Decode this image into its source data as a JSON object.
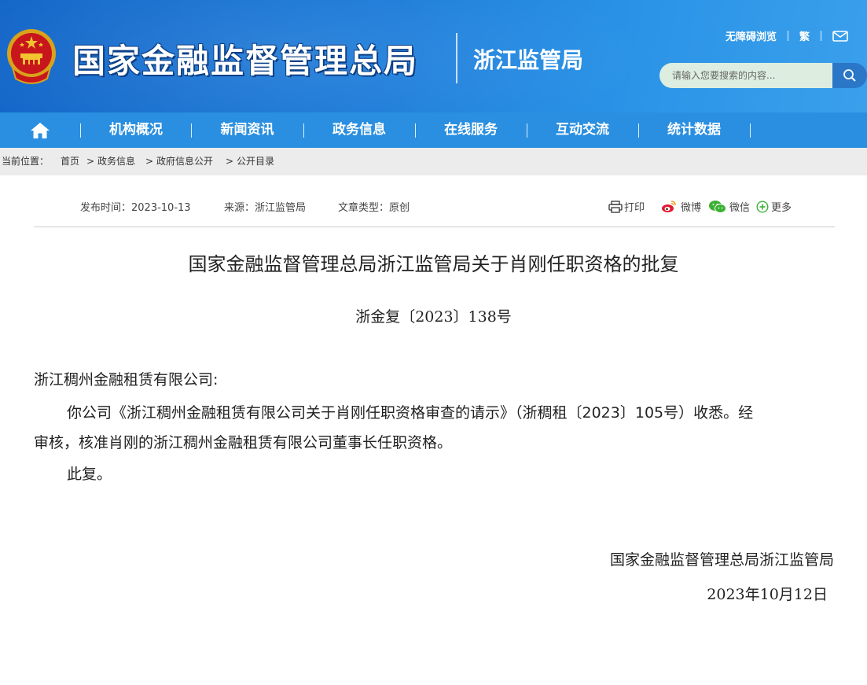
{
  "header": {
    "site_title": "国家金融监督管理总局",
    "sub_title": "浙江监管局",
    "top_links": {
      "accessibility": "无障碍浏览",
      "traditional": "繁"
    },
    "search": {
      "placeholder": "请输入您要搜索的内容..."
    },
    "colors": {
      "header_blue": "#1a7bd9",
      "nav_blue": "#2a8fe0",
      "search_bg": "#ddeee0"
    }
  },
  "nav": {
    "items": [
      {
        "label": "机构概况"
      },
      {
        "label": "新闻资讯"
      },
      {
        "label": "政务信息"
      },
      {
        "label": "在线服务"
      },
      {
        "label": "互动交流"
      },
      {
        "label": "统计数据"
      }
    ]
  },
  "breadcrumb": {
    "prefix": "当前位置：",
    "items": [
      "首页",
      "政务信息",
      "政府信息公开",
      "公开目录"
    ],
    "separator": ">"
  },
  "meta": {
    "publish_time": "发布时间：2023-10-13",
    "source": "来源：浙江监管局",
    "article_type": "文章类型：原创"
  },
  "share": {
    "print": "打印",
    "weibo": "微博",
    "wechat": "微信",
    "more": "更多"
  },
  "document": {
    "title": "国家金融监督管理总局浙江监管局关于肖刚任职资格的批复",
    "number": "浙金复〔2023〕138号",
    "addressee": "浙江稠州金融租赁有限公司:",
    "paragraph1_line1": "你公司《浙江稠州金融租赁有限公司关于肖刚任职资格审查的请示》（浙稠租〔2023〕105号）收悉。经",
    "paragraph1_line2": "审核，核准肖刚的浙江稠州金融租赁有限公司董事长任职资格。",
    "closing": "此复。",
    "signature": "国家金融监督管理总局浙江监管局",
    "date": "2023年10月12日"
  }
}
